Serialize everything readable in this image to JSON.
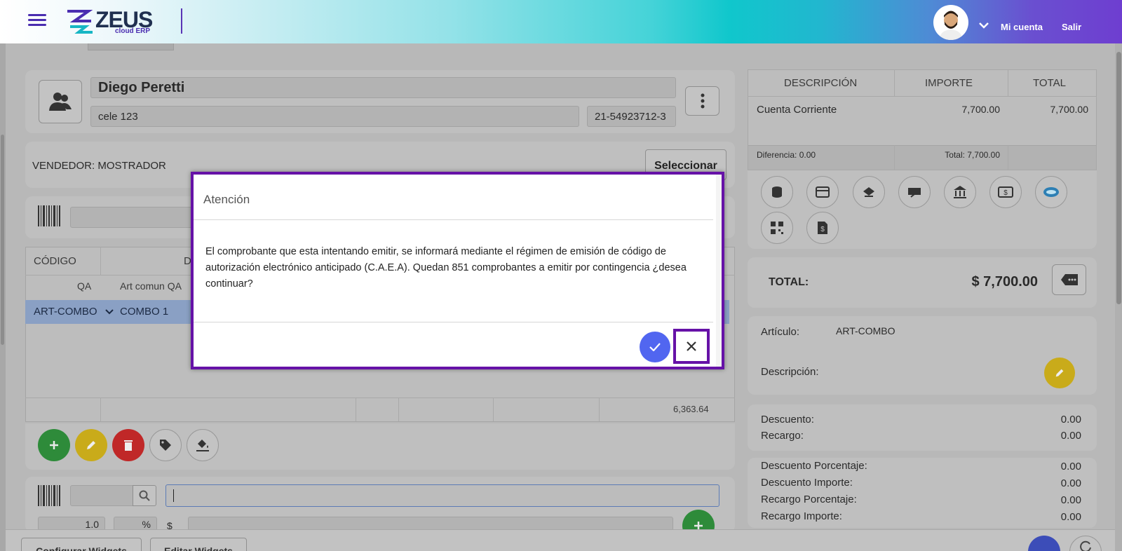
{
  "header": {
    "brand": "ZEUS",
    "brand_sub": "cloud ERP",
    "account_label": "Mi cuenta",
    "logout_label": "Salir"
  },
  "client": {
    "name": "Diego Peretti",
    "address": "cele 123",
    "cuit": "21-54923712-3"
  },
  "seller": {
    "label": "VENDEDOR: MOSTRADOR",
    "select_button": "Seleccionar"
  },
  "items_table": {
    "columns": [
      "CÓDIGO",
      "D"
    ],
    "filter_row": {
      "code": "QA",
      "desc": "Art comun QA"
    },
    "rows": [
      {
        "code": "ART-COMBO",
        "desc": "COMBO 1"
      }
    ],
    "footer_value": "6,363.64"
  },
  "entry": {
    "quantity": "1.0",
    "percent_symbol": "%",
    "currency_symbol": "$"
  },
  "bottom_buttons": {
    "configure": "Configurar Widgets",
    "edit": "Editar Widgets"
  },
  "payments": {
    "columns": [
      "DESCRIPCIÓN",
      "IMPORTE",
      "TOTAL"
    ],
    "rows": [
      {
        "desc": "Cuenta Corriente",
        "importe": "7,700.00",
        "total": "7,700.00"
      }
    ],
    "difference": "Diferencia: 0.00",
    "total": "Total: 7,700.00",
    "methods": [
      "coins-icon",
      "credit-card-icon",
      "transfer-icon",
      "check-icon",
      "bank-icon",
      "cash-icon",
      "mercadopago-icon",
      "qr-code-icon",
      "invoice-dollar-icon"
    ]
  },
  "total_box": {
    "label": "TOTAL:",
    "value": "$ 7,700.00"
  },
  "article": {
    "label": "Artículo:",
    "value": "ART-COMBO",
    "desc_label": "Descripción:"
  },
  "adjustments": {
    "descuento_label": "Descuento:",
    "descuento": "0.00",
    "recargo_label": "Recargo:",
    "recargo": "0.00"
  },
  "details": {
    "rows": [
      {
        "label": "Descuento Porcentaje:",
        "value": "0.00"
      },
      {
        "label": "Descuento Importe:",
        "value": "0.00"
      },
      {
        "label": "Recargo Porcentaje:",
        "value": "0.00"
      },
      {
        "label": "Recargo Importe:",
        "value": "0.00"
      }
    ]
  },
  "modal": {
    "title": "Atención",
    "message": "El comprobante que esta intentando emitir, se informará mediante el régimen de emisión de código de autorización electrónico anticipado (C.A.E.A). Quedan 851 comprobantes a emitir por contingencia ¿desea continuar?"
  },
  "colors": {
    "accent_purple": "#6612a7",
    "confirm_blue": "#5166f0",
    "add_green": "#2e8b3a",
    "edit_yellow": "#c9ab1a",
    "delete_red": "#c02828"
  }
}
